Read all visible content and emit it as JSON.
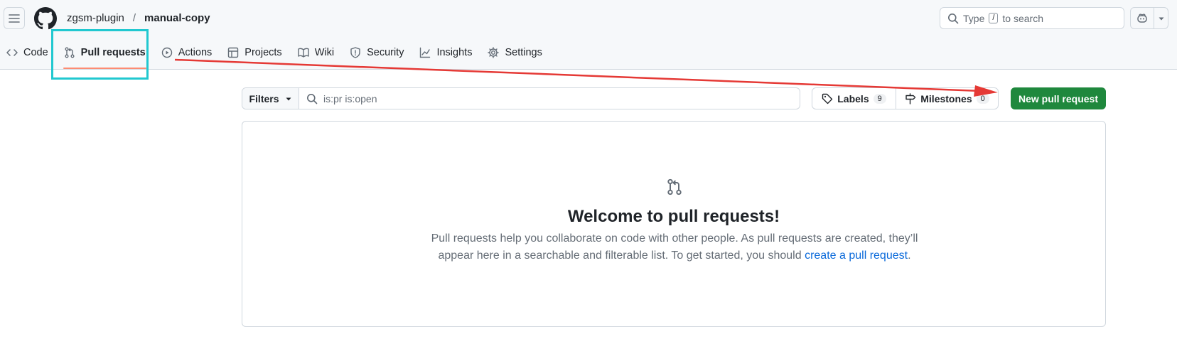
{
  "header": {
    "owner": "zgsm-plugin",
    "separator": "/",
    "repo": "manual-copy",
    "search_prefix": "Type",
    "search_key": "/",
    "search_suffix": "to search"
  },
  "tabs": [
    {
      "label": "Code",
      "icon": "code-icon"
    },
    {
      "label": "Pull requests",
      "icon": "git-pull-request-icon",
      "active": true
    },
    {
      "label": "Actions",
      "icon": "play-icon"
    },
    {
      "label": "Projects",
      "icon": "table-icon"
    },
    {
      "label": "Wiki",
      "icon": "book-icon"
    },
    {
      "label": "Security",
      "icon": "shield-icon"
    },
    {
      "label": "Insights",
      "icon": "graph-icon"
    },
    {
      "label": "Settings",
      "icon": "gear-icon"
    }
  ],
  "toolbar": {
    "filters_label": "Filters",
    "filter_value": "is:pr is:open",
    "labels_label": "Labels",
    "labels_count": "9",
    "milestones_label": "Milestones",
    "milestones_count": "0",
    "new_pr_label": "New pull request"
  },
  "blankslate": {
    "title": "Welcome to pull requests!",
    "desc_line1": "Pull requests help you collaborate on code with other people. As pull requests are created, they’ll",
    "desc_line2": "appear here in a searchable and filterable list. To get started, you should",
    "link_text": "create a pull request",
    "period": "."
  },
  "colors": {
    "primary_green": "#1f883d",
    "link_blue": "#0969da",
    "tab_underline": "#fd8c73",
    "annotation_box": "#21c8d0",
    "annotation_arrow": "#e53935"
  }
}
